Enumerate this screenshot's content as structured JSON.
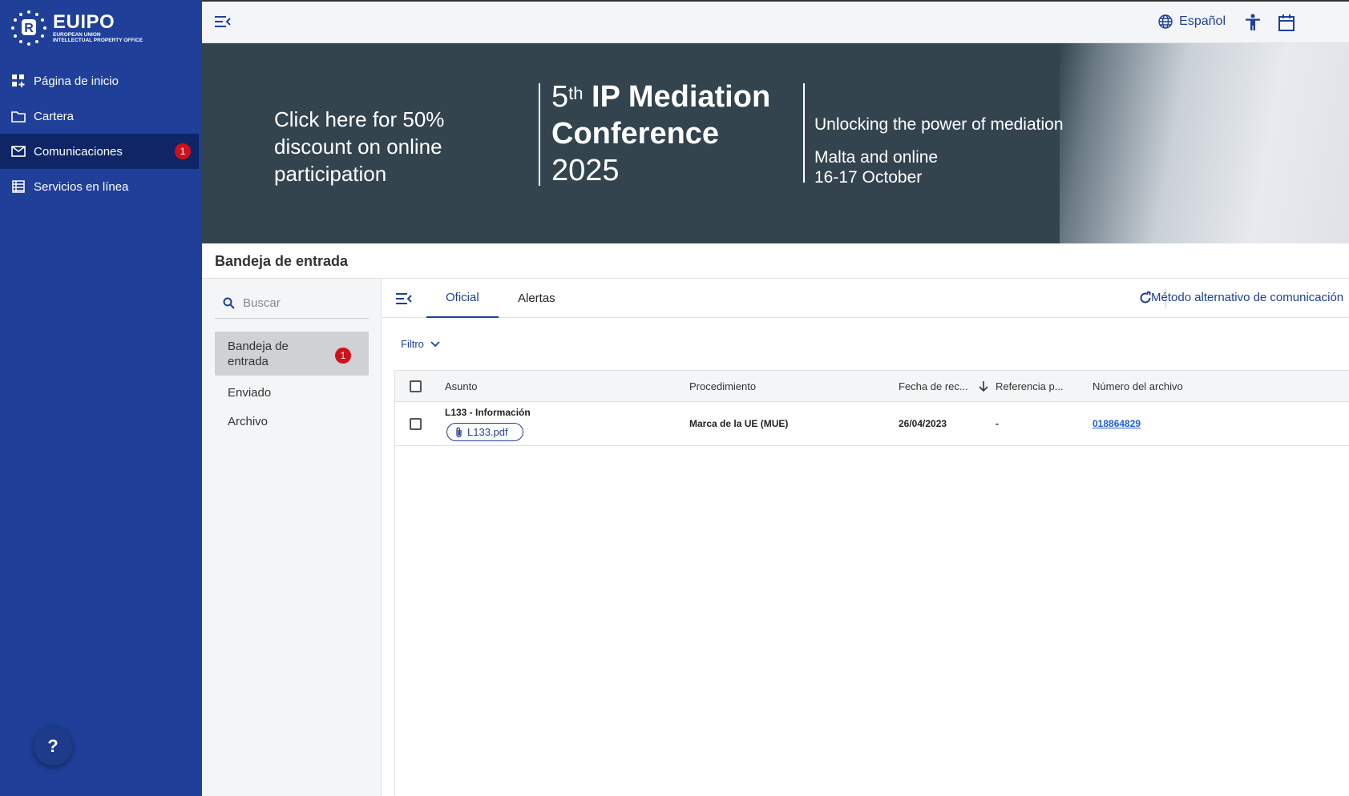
{
  "colors": {
    "sidebar": "#1f3f99",
    "sidebar_active": "#0f2566",
    "accent": "#1f3f99",
    "badge": "#d0101c",
    "banner": "#33444f"
  },
  "logo": {
    "name": "EUIPO",
    "line1": "EUROPEAN UNION",
    "line2": "INTELLECTUAL PROPERTY OFFICE"
  },
  "sidebar": {
    "items": [
      {
        "label": "Página de inicio",
        "icon": "dashboard-icon"
      },
      {
        "label": "Cartera",
        "icon": "folder-icon"
      },
      {
        "label": "Comunicaciones",
        "icon": "mail-icon",
        "badge": "1",
        "active": true
      },
      {
        "label": "Servicios en línea",
        "icon": "list-icon"
      }
    ],
    "help": "?"
  },
  "topbar": {
    "language": "Español",
    "icons": [
      "menu-collapse-icon",
      "globe-icon",
      "accessibility-icon",
      "calendar-icon"
    ]
  },
  "banner": {
    "cta": "Click here for 50% discount on online participation",
    "title_num": "5",
    "title_sup": "th",
    "title_main": " IP Mediation",
    "title_line2": "Conference",
    "title_year": "2025",
    "tagline": "Unlocking the power of mediation",
    "place": "Malta and online",
    "dates": "16-17 October"
  },
  "page": {
    "title": "Bandeja de entrada"
  },
  "search": {
    "placeholder": "Buscar"
  },
  "folders": [
    {
      "label": "Bandeja de entrada",
      "badge": "1",
      "active": true
    },
    {
      "label": "Enviado"
    },
    {
      "label": "Archivo"
    }
  ],
  "tabs": [
    {
      "label": "Oficial",
      "active": true
    },
    {
      "label": "Alertas"
    }
  ],
  "alt_method": "Método alternativo de comunicación",
  "filter": "Filtro",
  "table": {
    "columns": [
      "Asunto",
      "Procedimiento",
      "Fecha de rec...",
      "Referencia p...",
      "Número del archivo"
    ],
    "rows": [
      {
        "subject": "L133 - Información",
        "attachment": "L133.pdf",
        "procedure": "Marca de la UE (MUE)",
        "date": "26/04/2023",
        "reference": "-",
        "file_number": "018864829"
      }
    ]
  }
}
